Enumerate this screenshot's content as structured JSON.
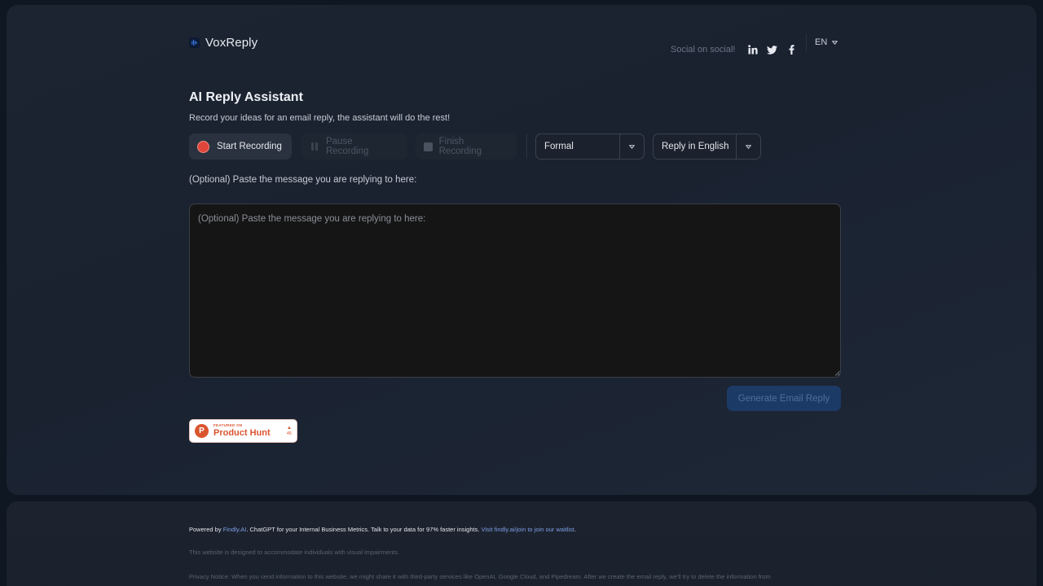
{
  "header": {
    "brand_name": "VoxReply",
    "social_label": "Social on social!",
    "social_icons": [
      "linkedin-icon",
      "twitter-icon",
      "facebook-icon"
    ],
    "language": "EN"
  },
  "main": {
    "title": "AI Reply Assistant",
    "subtitle": "Record your ideas for an email reply, the assistant will do the rest!",
    "buttons": {
      "start": "Start Recording",
      "pause": "Pause Recording",
      "finish": "Finish Recording"
    },
    "tone_select": {
      "value": "Formal"
    },
    "language_select": {
      "value": "Reply in English"
    },
    "paste_label": "(Optional) Paste the message you are replying to here:",
    "paste_placeholder": "(Optional) Paste the message you are replying to here:",
    "generate": "Generate Email Reply"
  },
  "product_hunt": {
    "featured": "FEATURED ON",
    "name": "Product Hunt",
    "votes": "45"
  },
  "footer": {
    "powered_prefix": "Powered by ",
    "powered_link": "Findly.AI",
    "powered_middle": ". ChatGPT for your Internal Business Metrics. Talk to your data for 97% faster insights. ",
    "waitlist_link": "Visit findly.ai/join to join our waitlist",
    "powered_suffix": ".",
    "accessibility": "This website is designed to accommodate individuals with visual impairments.",
    "privacy": "Privacy Notice: When you send information to this website, we might share it with third-party services like OpenAI, Google Cloud, and Pipedream. After we create the email reply, we'll try to delete the information from"
  },
  "colors": {
    "accent_blue": "#1c3a66",
    "record_red": "#e0463a",
    "product_hunt": "#da552f"
  }
}
